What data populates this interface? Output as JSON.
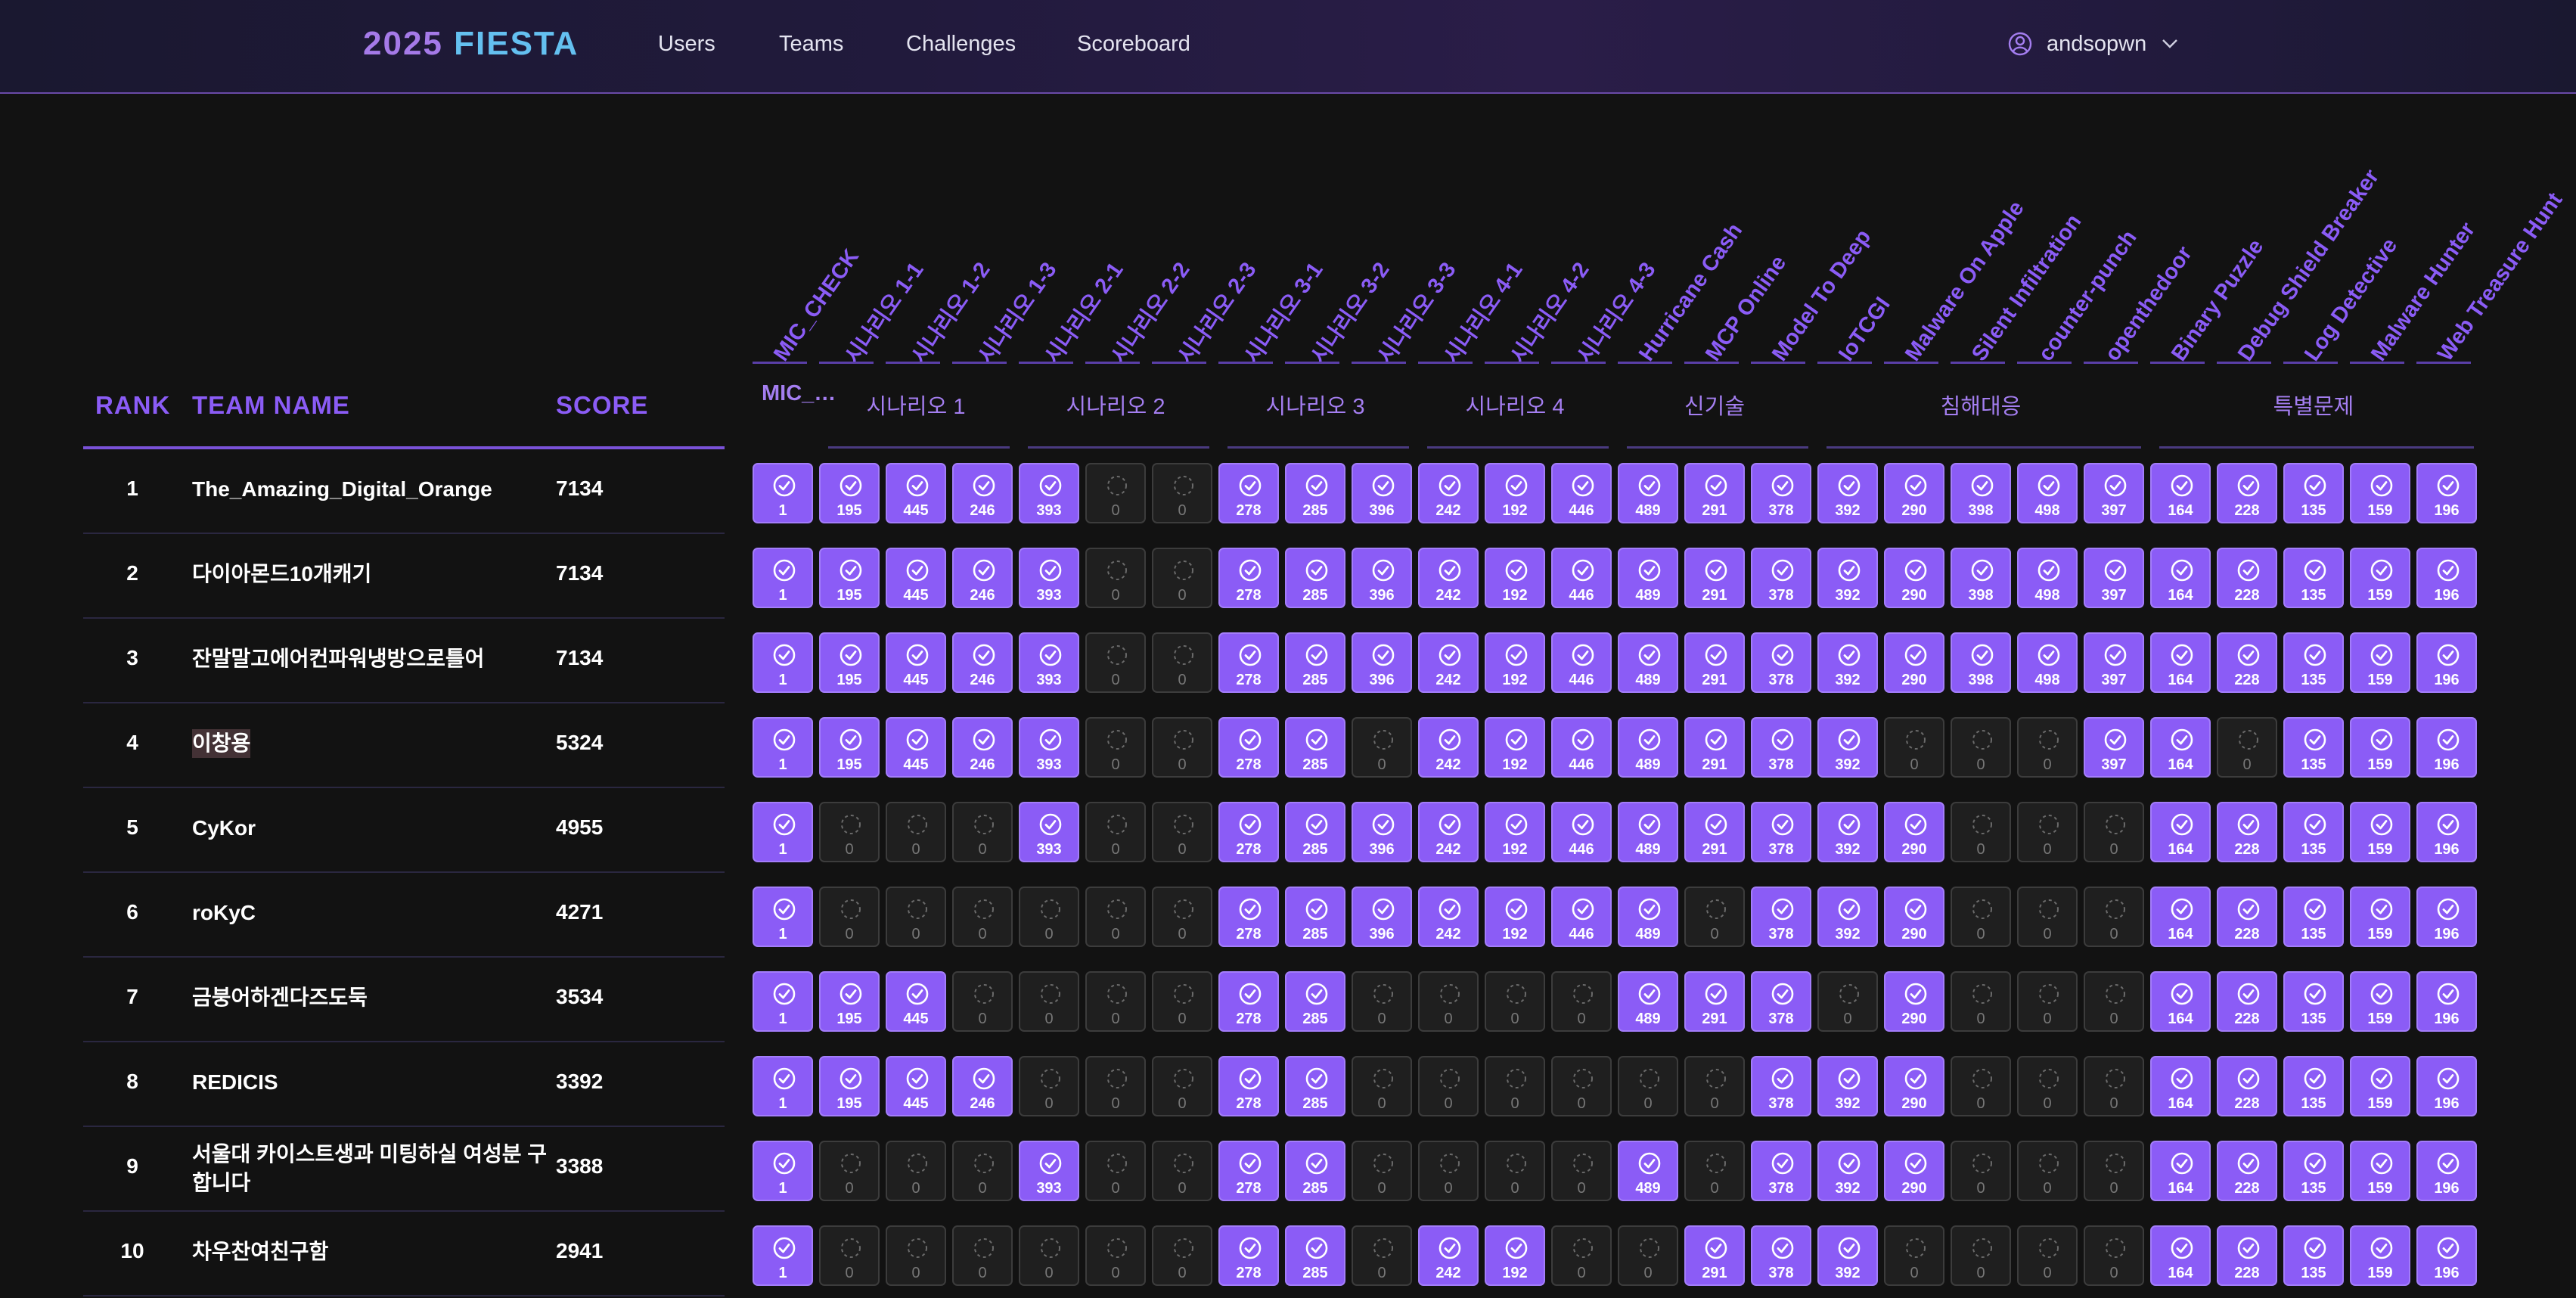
{
  "nav": {
    "brand_year": "2025",
    "brand_name": "FIESTA",
    "links": [
      "Users",
      "Teams",
      "Challenges",
      "Scoreboard"
    ],
    "user": "andsopwn"
  },
  "table": {
    "headers": {
      "rank": "RANK",
      "team": "TEAM NAME",
      "score": "SCORE"
    }
  },
  "challenges": [
    "MIC_CHECK",
    "시나리오 1-1",
    "시나리오 1-2",
    "시나리오 1-3",
    "시나리오 2-1",
    "시나리오 2-2",
    "시나리오 2-3",
    "시나리오 3-1",
    "시나리오 3-2",
    "시나리오 3-3",
    "시나리오 4-1",
    "시나리오 4-2",
    "시나리오 4-3",
    "Hurricane Cash",
    "MCP Online",
    "Model To Deep",
    "IoTCGI",
    "Malware On Apple",
    "Silent Infiltration",
    "counter-punch",
    "openthedoor",
    "Binary Puzzle",
    "Debug Shield Breaker",
    "Log Detective",
    "Malware Hunter",
    "Web Treasure Hunt"
  ],
  "categories": [
    {
      "label": "MIC_…",
      "start": 0,
      "end": 0
    },
    {
      "label": "시나리오 1",
      "start": 1,
      "end": 3
    },
    {
      "label": "시나리오 2",
      "start": 4,
      "end": 6
    },
    {
      "label": "시나리오 3",
      "start": 7,
      "end": 9
    },
    {
      "label": "시나리오 4",
      "start": 10,
      "end": 12
    },
    {
      "label": "신기술",
      "start": 13,
      "end": 15
    },
    {
      "label": "침해대응",
      "start": 16,
      "end": 20
    },
    {
      "label": "특별문제",
      "start": 21,
      "end": 25
    }
  ],
  "teams": [
    {
      "rank": "1",
      "name": "The_Amazing_Digital_Orange",
      "score": "7134",
      "cells": [
        1,
        195,
        445,
        246,
        393,
        0,
        0,
        278,
        285,
        396,
        242,
        192,
        446,
        489,
        291,
        378,
        392,
        290,
        398,
        498,
        397,
        164,
        228,
        135,
        159,
        196
      ],
      "solved": [
        1,
        1,
        1,
        1,
        1,
        0,
        0,
        1,
        1,
        1,
        1,
        1,
        1,
        1,
        1,
        1,
        1,
        1,
        1,
        1,
        1,
        1,
        1,
        1,
        1,
        1
      ]
    },
    {
      "rank": "2",
      "name": "다이아몬드10개캐기",
      "score": "7134",
      "cells": [
        1,
        195,
        445,
        246,
        393,
        0,
        0,
        278,
        285,
        396,
        242,
        192,
        446,
        489,
        291,
        378,
        392,
        290,
        398,
        498,
        397,
        164,
        228,
        135,
        159,
        196
      ],
      "solved": [
        1,
        1,
        1,
        1,
        1,
        0,
        0,
        1,
        1,
        1,
        1,
        1,
        1,
        1,
        1,
        1,
        1,
        1,
        1,
        1,
        1,
        1,
        1,
        1,
        1,
        1
      ]
    },
    {
      "rank": "3",
      "name": "잔말말고에어컨파워냉방으로틀어",
      "score": "7134",
      "cells": [
        1,
        195,
        445,
        246,
        393,
        0,
        0,
        278,
        285,
        396,
        242,
        192,
        446,
        489,
        291,
        378,
        392,
        290,
        398,
        498,
        397,
        164,
        228,
        135,
        159,
        196
      ],
      "solved": [
        1,
        1,
        1,
        1,
        1,
        0,
        0,
        1,
        1,
        1,
        1,
        1,
        1,
        1,
        1,
        1,
        1,
        1,
        1,
        1,
        1,
        1,
        1,
        1,
        1,
        1
      ]
    },
    {
      "rank": "4",
      "name": "이창용",
      "score": "5324",
      "cells": [
        1,
        195,
        445,
        246,
        393,
        0,
        0,
        278,
        285,
        0,
        242,
        192,
        446,
        489,
        291,
        378,
        392,
        0,
        0,
        0,
        397,
        164,
        0,
        135,
        159,
        196
      ],
      "solved": [
        1,
        1,
        1,
        1,
        1,
        0,
        0,
        1,
        1,
        0,
        1,
        1,
        1,
        1,
        1,
        1,
        1,
        0,
        0,
        0,
        1,
        1,
        0,
        1,
        1,
        1
      ]
    },
    {
      "rank": "5",
      "name": "CyKor",
      "score": "4955",
      "cells": [
        1,
        0,
        0,
        0,
        393,
        0,
        0,
        278,
        285,
        396,
        242,
        192,
        446,
        489,
        291,
        378,
        392,
        290,
        0,
        0,
        0,
        164,
        228,
        135,
        159,
        196
      ],
      "solved": [
        1,
        0,
        0,
        0,
        1,
        0,
        0,
        1,
        1,
        1,
        1,
        1,
        1,
        1,
        1,
        1,
        1,
        1,
        0,
        0,
        0,
        1,
        1,
        1,
        1,
        1
      ]
    },
    {
      "rank": "6",
      "name": "roKyC",
      "score": "4271",
      "cells": [
        1,
        0,
        0,
        0,
        0,
        0,
        0,
        278,
        285,
        396,
        242,
        192,
        446,
        489,
        0,
        378,
        392,
        290,
        0,
        0,
        0,
        164,
        228,
        135,
        159,
        196
      ],
      "solved": [
        1,
        0,
        0,
        0,
        0,
        0,
        0,
        1,
        1,
        1,
        1,
        1,
        1,
        1,
        0,
        1,
        1,
        1,
        0,
        0,
        0,
        1,
        1,
        1,
        1,
        1
      ]
    },
    {
      "rank": "7",
      "name": "금붕어하겐다즈도둑",
      "score": "3534",
      "cells": [
        1,
        195,
        445,
        0,
        0,
        0,
        0,
        278,
        285,
        0,
        0,
        0,
        0,
        489,
        291,
        378,
        0,
        290,
        0,
        0,
        0,
        164,
        228,
        135,
        159,
        196
      ],
      "solved": [
        1,
        1,
        1,
        0,
        0,
        0,
        0,
        1,
        1,
        0,
        0,
        0,
        0,
        1,
        1,
        1,
        0,
        1,
        0,
        0,
        0,
        1,
        1,
        1,
        1,
        1
      ]
    },
    {
      "rank": "8",
      "name": "REDICIS",
      "score": "3392",
      "cells": [
        1,
        195,
        445,
        246,
        0,
        0,
        0,
        278,
        285,
        0,
        0,
        0,
        0,
        0,
        0,
        378,
        392,
        290,
        0,
        0,
        0,
        164,
        228,
        135,
        159,
        196
      ],
      "solved": [
        1,
        1,
        1,
        1,
        0,
        0,
        0,
        1,
        1,
        0,
        0,
        0,
        0,
        0,
        0,
        1,
        1,
        1,
        0,
        0,
        0,
        1,
        1,
        1,
        1,
        1
      ]
    },
    {
      "rank": "9",
      "name": "서울대 카이스트생과 미팅하실 여성분 구합니다",
      "score": "3388",
      "cells": [
        1,
        0,
        0,
        0,
        393,
        0,
        0,
        278,
        285,
        0,
        0,
        0,
        0,
        489,
        0,
        378,
        392,
        290,
        0,
        0,
        0,
        164,
        228,
        135,
        159,
        196
      ],
      "solved": [
        1,
        0,
        0,
        0,
        1,
        0,
        0,
        1,
        1,
        0,
        0,
        0,
        0,
        1,
        0,
        1,
        1,
        1,
        0,
        0,
        0,
        1,
        1,
        1,
        1,
        1
      ]
    },
    {
      "rank": "10",
      "name": "차우찬여친구함",
      "score": "2941",
      "cells": [
        1,
        0,
        0,
        0,
        0,
        0,
        0,
        278,
        285,
        0,
        242,
        192,
        0,
        0,
        291,
        378,
        392,
        0,
        0,
        0,
        0,
        164,
        228,
        135,
        159,
        196
      ],
      "solved": [
        1,
        0,
        0,
        0,
        0,
        0,
        0,
        1,
        1,
        0,
        1,
        1,
        0,
        0,
        1,
        1,
        1,
        0,
        0,
        0,
        0,
        1,
        1,
        1,
        1,
        1
      ]
    }
  ],
  "colors": {
    "solved": "#8b5cf6",
    "unsolved": "#1f1f1f",
    "accent": "#8b5cf6"
  },
  "icons": {
    "solved": "check-circle-icon",
    "unsolved": "dashed-circle-icon",
    "user": "user-circle-icon",
    "dropdown": "chevron-down-icon"
  }
}
